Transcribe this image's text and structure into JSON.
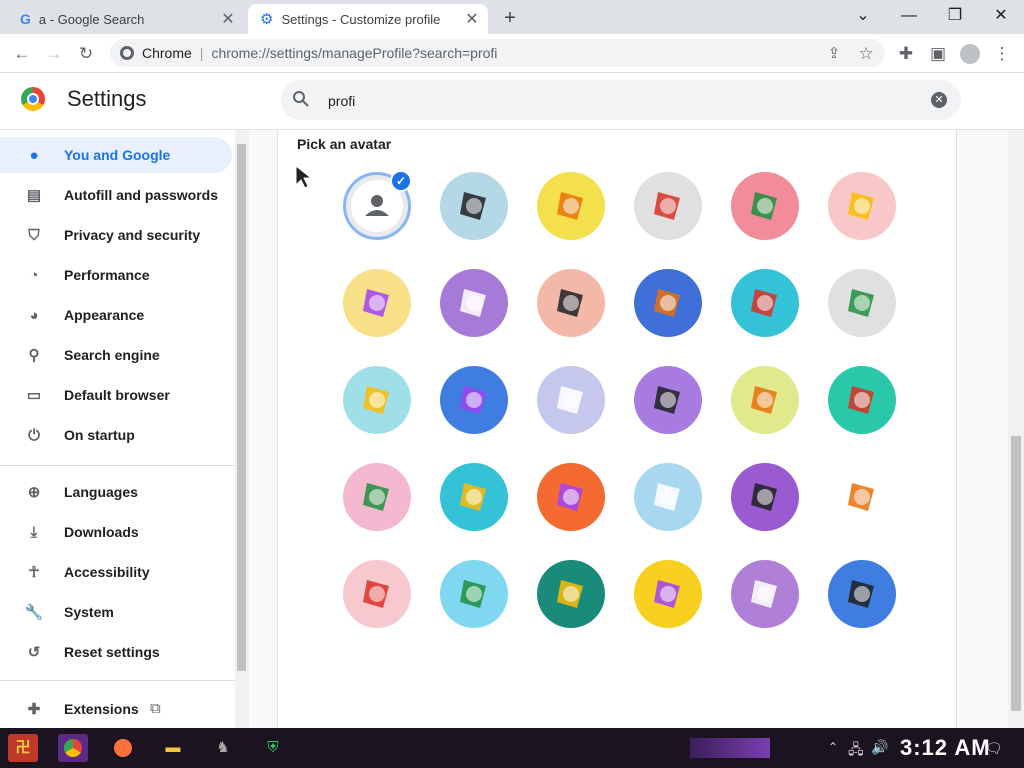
{
  "browser": {
    "tabs": [
      {
        "title": "a - Google Search",
        "favicon": "google-g-icon"
      },
      {
        "title": "Settings - Customize profile",
        "favicon": "gear-icon"
      }
    ],
    "omnibox": {
      "site": "Chrome",
      "url": "chrome://settings/manageProfile?search=profi"
    }
  },
  "settings": {
    "title": "Settings",
    "search_value": "profi",
    "sidebar": [
      {
        "label": "You and Google",
        "icon": "person-icon",
        "active": true
      },
      {
        "label": "Autofill and passwords",
        "icon": "clipboard-icon"
      },
      {
        "label": "Privacy and security",
        "icon": "shield-icon"
      },
      {
        "label": "Performance",
        "icon": "speedometer-icon"
      },
      {
        "label": "Appearance",
        "icon": "palette-icon"
      },
      {
        "label": "Search engine",
        "icon": "search-icon"
      },
      {
        "label": "Default browser",
        "icon": "browser-window-icon"
      },
      {
        "label": "On startup",
        "icon": "power-icon"
      },
      {
        "label": "Languages",
        "icon": "globe-icon"
      },
      {
        "label": "Downloads",
        "icon": "download-icon"
      },
      {
        "label": "Accessibility",
        "icon": "accessibility-icon"
      },
      {
        "label": "System",
        "icon": "wrench-icon"
      },
      {
        "label": "Reset settings",
        "icon": "reset-history-icon"
      },
      {
        "label": "Extensions",
        "icon": "puzzle-icon"
      }
    ],
    "section_label": "Pick an avatar",
    "avatars": [
      {
        "name": "default-person",
        "bg": "#e8eaed"
      },
      {
        "name": "origami-cat",
        "bg": "#b4d8e6"
      },
      {
        "name": "origami-corgi",
        "bg": "#f4e04d"
      },
      {
        "name": "origami-dragon",
        "bg": "#e0e0e0"
      },
      {
        "name": "origami-elephant",
        "bg": "#f28b9a"
      },
      {
        "name": "origami-fox",
        "bg": "#f8c8c8"
      },
      {
        "name": "origami-monkey",
        "bg": "#f8e088"
      },
      {
        "name": "origami-panda",
        "bg": "#a67bd8"
      },
      {
        "name": "origami-penguin",
        "bg": "#f4b8a8"
      },
      {
        "name": "origami-cardinal",
        "bg": "#3f6fd8"
      },
      {
        "name": "origami-rabbit",
        "bg": "#34c3d6"
      },
      {
        "name": "origami-unicorn",
        "bg": "#e0e0e0"
      },
      {
        "name": "basketball",
        "bg": "#9fe0e8"
      },
      {
        "name": "bike",
        "bg": "#3f7de0"
      },
      {
        "name": "bird",
        "bg": "#c5c8ec"
      },
      {
        "name": "cheese",
        "bg": "#a87be0"
      },
      {
        "name": "football",
        "bg": "#e0ea8c"
      },
      {
        "name": "ramen",
        "bg": "#28c8a8"
      },
      {
        "name": "sunglasses",
        "bg": "#f4b8d0"
      },
      {
        "name": "sushi",
        "bg": "#34c3d6"
      },
      {
        "name": "tamagotchi",
        "bg": "#f46a30"
      },
      {
        "name": "vinyl",
        "bg": "#a8d8f0"
      },
      {
        "name": "avocado",
        "bg": "#9a5ad0"
      },
      {
        "name": "cappuccino",
        "bg": "#ffffff"
      },
      {
        "name": "ice-cream",
        "bg": "#f8c8d0"
      },
      {
        "name": "snowflake",
        "bg": "#80d8f0"
      },
      {
        "name": "watermelon",
        "bg": "#1a8a7a"
      },
      {
        "name": "onigiri",
        "bg": "#f8d020"
      },
      {
        "name": "pizza",
        "bg": "#b080d8"
      },
      {
        "name": "sandwich",
        "bg": "#3f7de0"
      }
    ]
  },
  "taskbar": {
    "clock": "3:12 AM"
  }
}
